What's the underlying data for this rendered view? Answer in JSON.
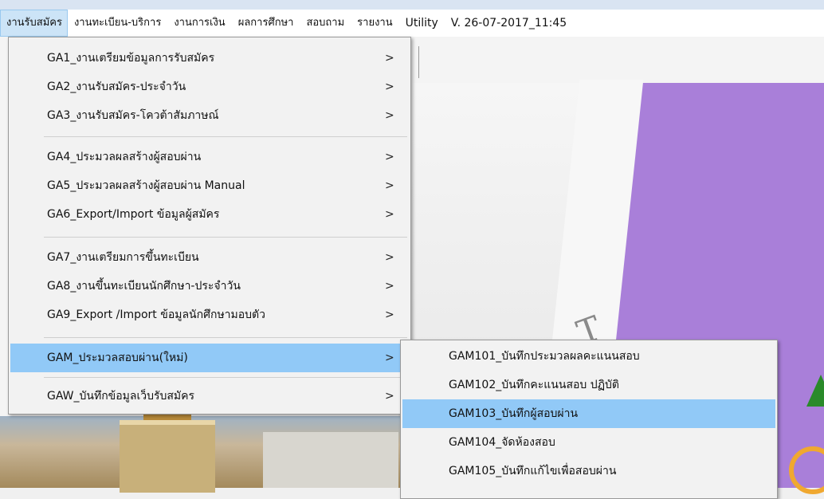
{
  "menubar": {
    "items": [
      {
        "label": "งานรับสมัคร"
      },
      {
        "label": "งานทะเบียน-บริการ"
      },
      {
        "label": "งานการเงิน"
      },
      {
        "label": "ผลการศึกษา"
      },
      {
        "label": "สอบถาม"
      },
      {
        "label": "รายงาน"
      },
      {
        "label": "Utility"
      },
      {
        "label": "V. 26-07-2017_11:45"
      }
    ]
  },
  "menu": {
    "items": [
      {
        "label": "GA1_งานเตรียมข้อมูลการรับสมัคร",
        "arrow": ">"
      },
      {
        "label": "GA2_งานรับสมัคร-ประจำวัน",
        "arrow": ">"
      },
      {
        "label": "GA3_งานรับสมัคร-โควต้าสัมภาษณ์",
        "arrow": ">"
      },
      {
        "label": "GA4_ประมวลผลสร้างผู้สอบผ่าน",
        "arrow": ">"
      },
      {
        "label": "GA5_ประมวลผลสร้างผู้สอบผ่าน Manual",
        "arrow": ">"
      },
      {
        "label": "GA6_Export/Import ข้อมูลผู้สมัคร",
        "arrow": ">"
      },
      {
        "label": "GA7_งานเตรียมการขึ้นทะเบียน",
        "arrow": ">"
      },
      {
        "label": "GA8_งานขึ้นทะเบียนนักศึกษา-ประจำวัน",
        "arrow": ">"
      },
      {
        "label": "GA9_Export /Import ข้อมูลนักศึกษามอบตัว",
        "arrow": ">"
      },
      {
        "label": "GAM_ประมวลสอบผ่าน(ใหม่)",
        "arrow": ">"
      },
      {
        "label": "GAW_บันทึกข้อมูลเว็บรับสมัคร",
        "arrow": ">"
      }
    ]
  },
  "submenu": {
    "items": [
      {
        "label": "GAM101_บันทึกประมวลผลคะแนนสอบ"
      },
      {
        "label": "GAM102_บันทึกคะแนนสอบ ปฏิบัติ"
      },
      {
        "label": "GAM103_บันทึกผู้สอบผ่าน"
      },
      {
        "label": "GAM104_จัดห้องสอบ"
      },
      {
        "label": "GAM105_บันทึกแก้ไขเพื่อสอบผ่าน"
      }
    ]
  },
  "colors": {
    "highlight": "#91c9f7",
    "menubar_active": "#cce4f7",
    "purple_background": "#a97fd9"
  }
}
